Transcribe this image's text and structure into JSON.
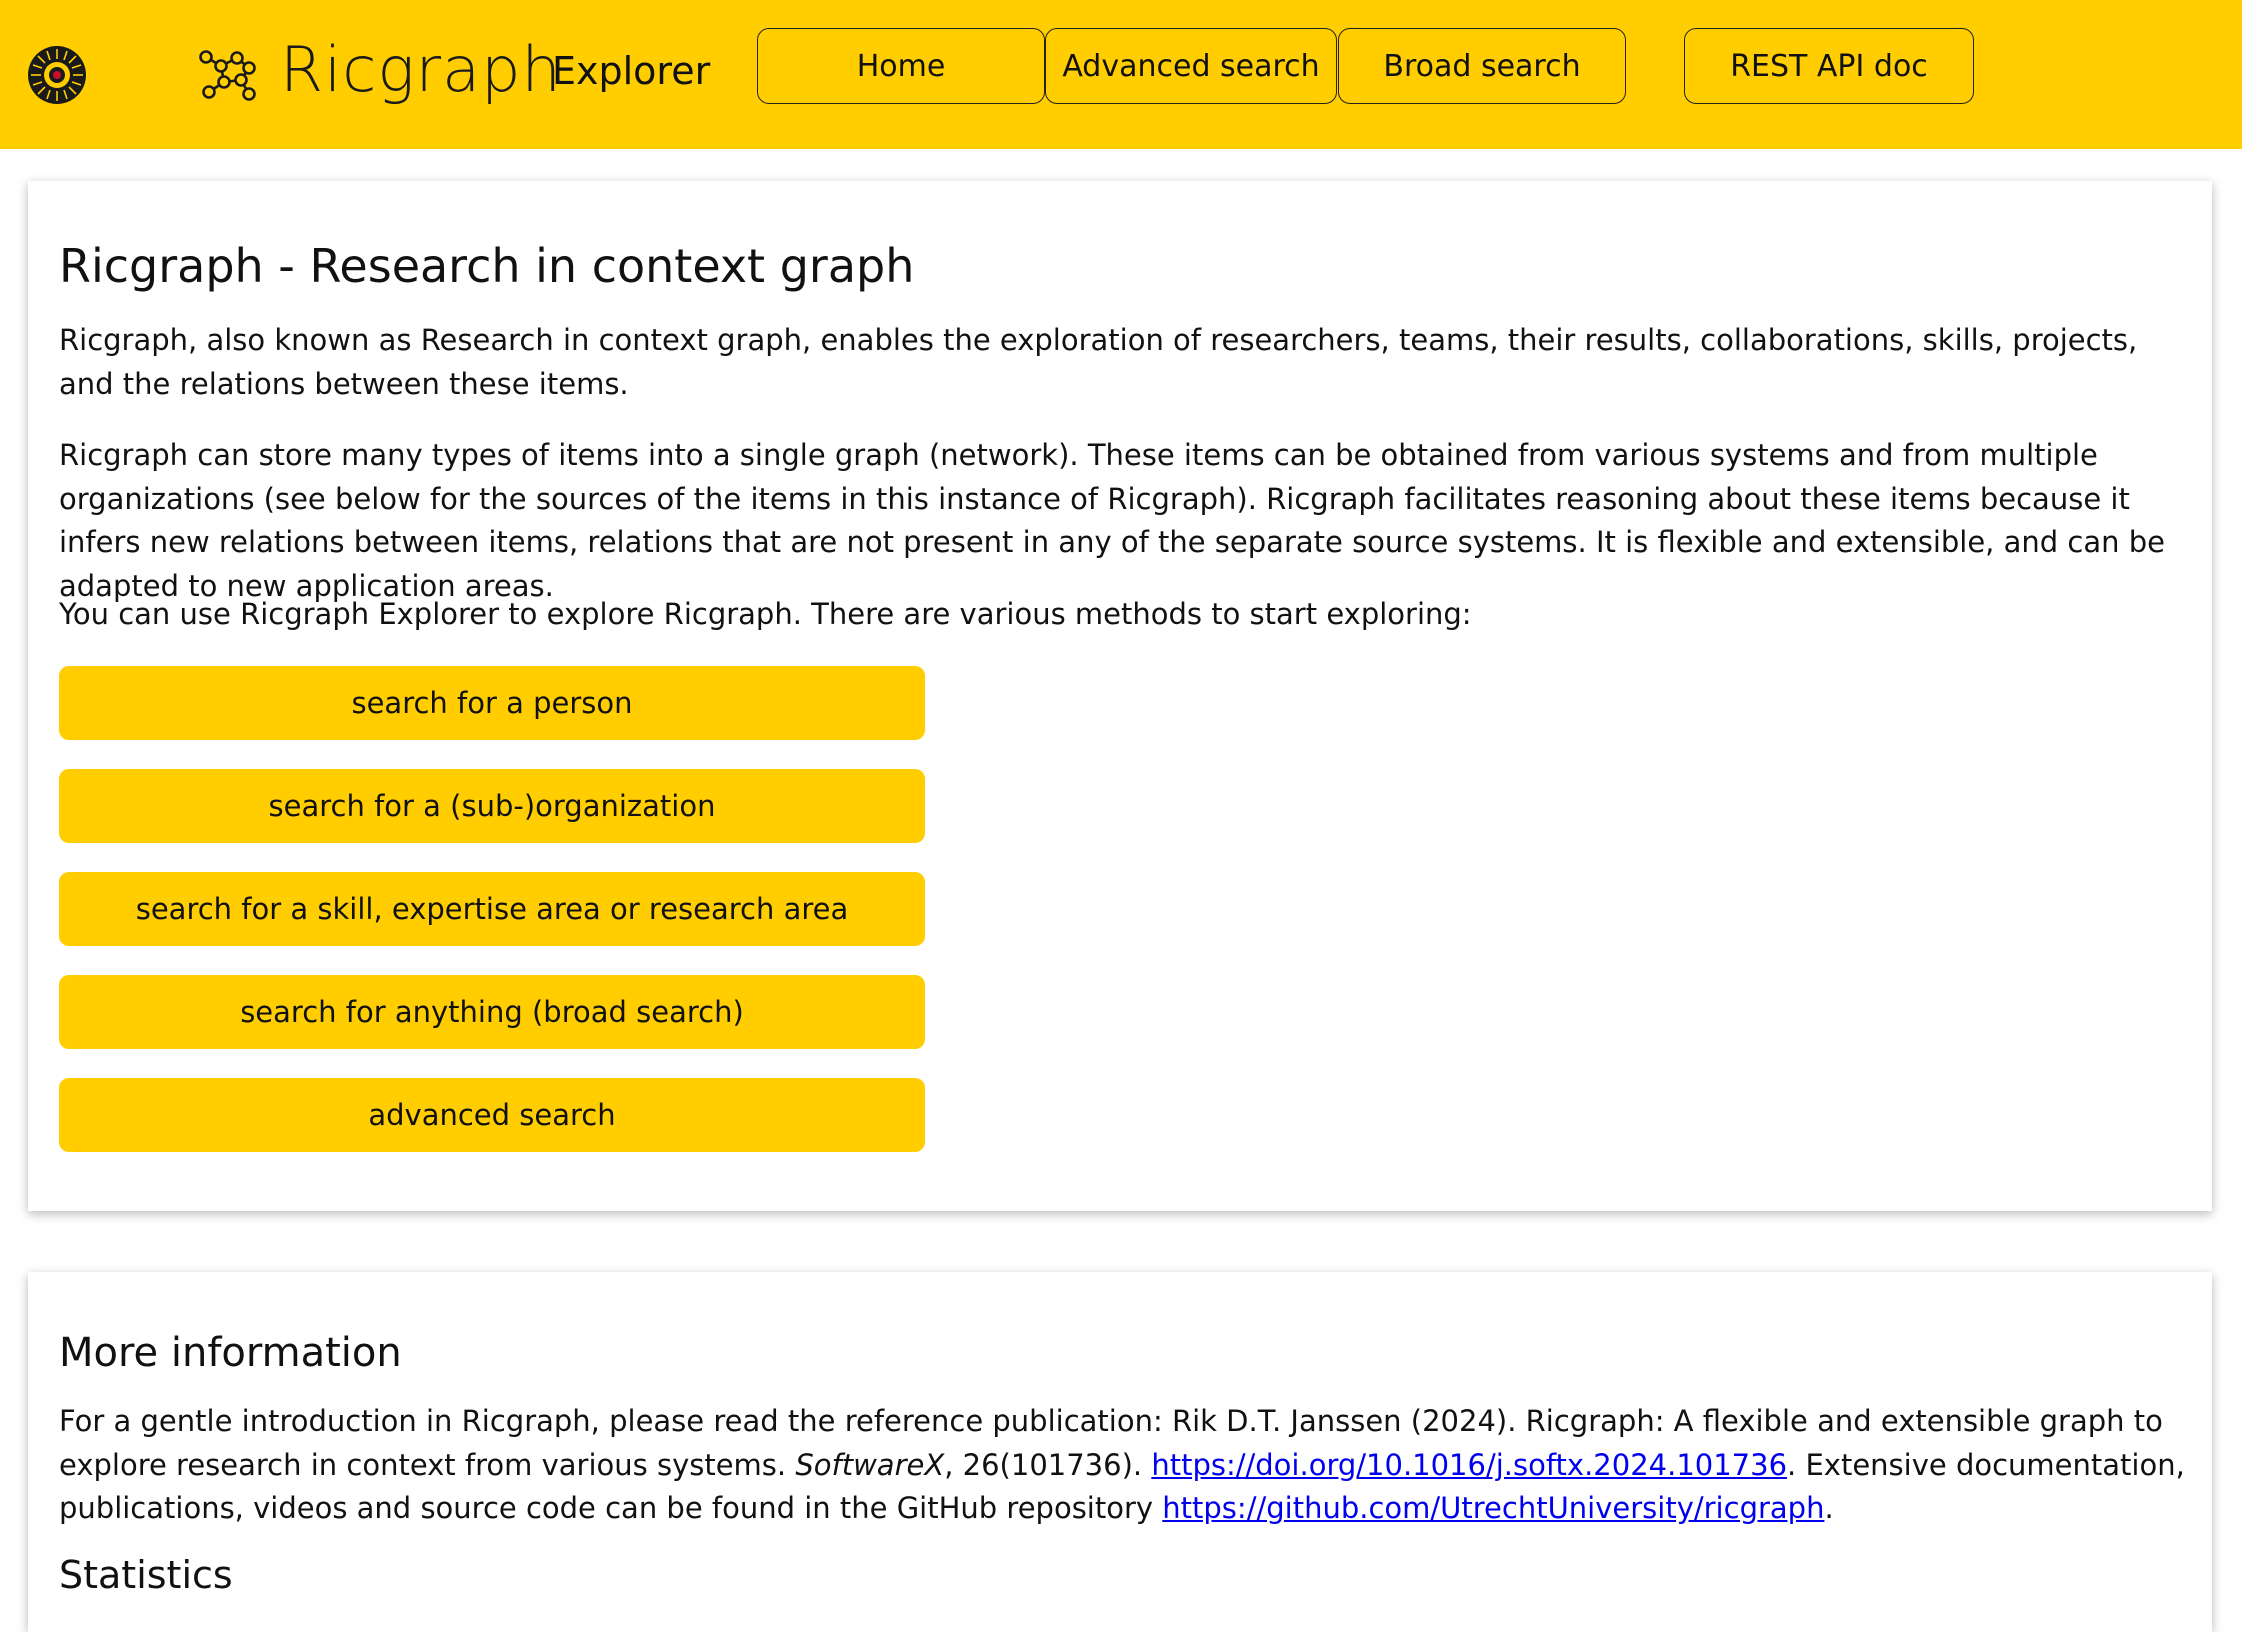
{
  "header": {
    "brand_name": "Ricgraph",
    "brand_suffix": "Explorer",
    "nav": {
      "home": "Home",
      "advanced_search": "Advanced search",
      "broad_search": "Broad search",
      "rest_api_doc": "REST API doc"
    },
    "colors": {
      "accent": "#ffcd00"
    }
  },
  "intro": {
    "title": "Ricgraph - Research in context graph",
    "para1": "Ricgraph, also known as Research in context graph, enables the exploration of researchers, teams, their results, collaborations, skills, projects, and the relations between these items.",
    "para2": "Ricgraph can store many types of items into a single graph (network). These items can be obtained from various systems and from multiple organizations (see below for the sources of the items in this instance of Ricgraph). Ricgraph facilitates reasoning about these items because it infers new relations between items, relations that are not present in any of the separate source systems. It is flexible and extensible, and can be adapted to new application areas.",
    "para3": "You can use Ricgraph Explorer to explore Ricgraph. There are various methods to start exploring:",
    "buttons": [
      "search for a person",
      "search for a (sub-)organization",
      "search for a skill, expertise area or research area",
      "search for anything (broad search)",
      "advanced search"
    ]
  },
  "more_info": {
    "title": "More information",
    "text_a": "For a gentle introduction in Ricgraph, please read the reference publication: Rik D.T. Janssen (2024). Ricgraph: A flexible and extensible graph to explore research in context from various systems. ",
    "journal": "SoftwareX",
    "text_b": ", 26(101736). ",
    "doi_link": "https://doi.org/10.1016/j.softx.2024.101736",
    "text_c": ". Extensive documentation, publications, videos and source code can be found in the GitHub repository ",
    "github_link": "https://github.com/UtrechtUniversity/ricgraph",
    "text_d": ".",
    "statistics_heading": "Statistics"
  }
}
